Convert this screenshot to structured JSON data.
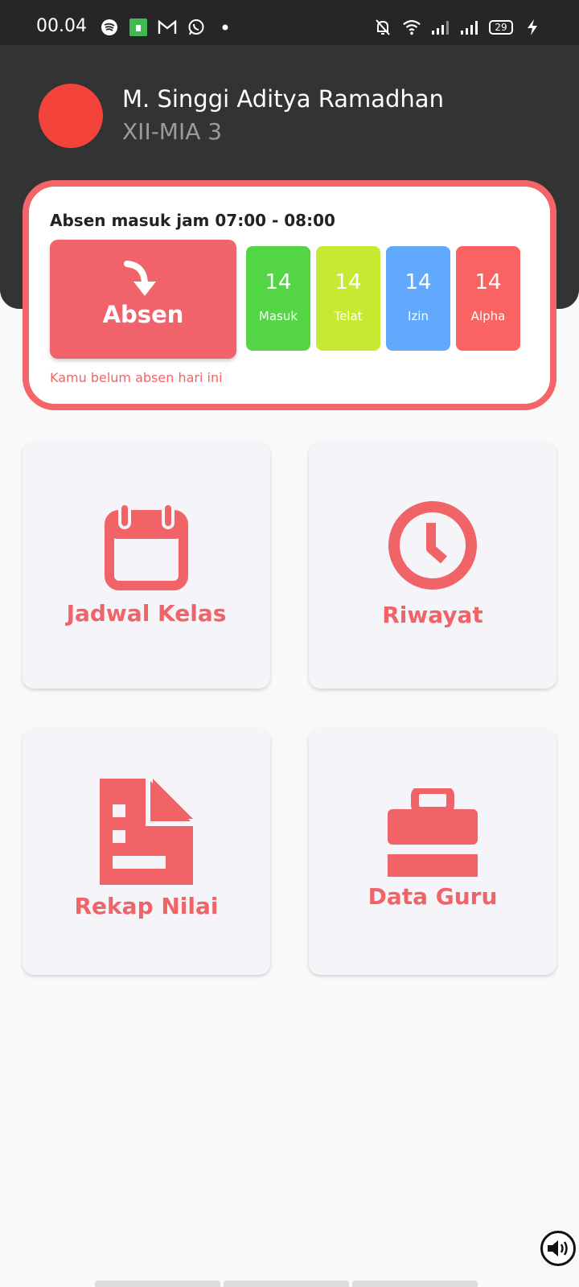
{
  "status_bar": {
    "time": "00.04",
    "battery": "29",
    "left_icons": [
      "spotify-icon",
      "app-icon",
      "gmail-icon",
      "whatsapp-icon",
      "dot-icon"
    ],
    "right_icons": [
      "bell-off-icon",
      "wifi-icon",
      "signal-icon",
      "signal-icon",
      "battery-icon",
      "charging-icon"
    ]
  },
  "profile": {
    "name": "M. Singgi Aditya Ramadhan",
    "class_name": "XII-MIA 3"
  },
  "attendance": {
    "title": "Absen masuk jam 07:00 - 08:00",
    "button_label": "Absen",
    "note": "Kamu belum absen hari ini",
    "stats": [
      {
        "value": "14",
        "label": "Masuk",
        "color": "#53d545"
      },
      {
        "value": "14",
        "label": "Telat",
        "color": "#c6ea32"
      },
      {
        "value": "14",
        "label": "Izin",
        "color": "#60a9fd"
      },
      {
        "value": "14",
        "label": "Alpha",
        "color": "#fa6362"
      }
    ]
  },
  "menu": [
    {
      "label": "Jadwal Kelas",
      "icon": "calendar-icon"
    },
    {
      "label": "Riwayat",
      "icon": "clock-icon"
    },
    {
      "label": "Rekap Nilai",
      "icon": "report-icon"
    },
    {
      "label": "Data Guru",
      "icon": "briefcase-icon"
    }
  ],
  "colors": {
    "accent": "#f06468",
    "header_bg": "#333333",
    "avatar": "#f4433a"
  }
}
